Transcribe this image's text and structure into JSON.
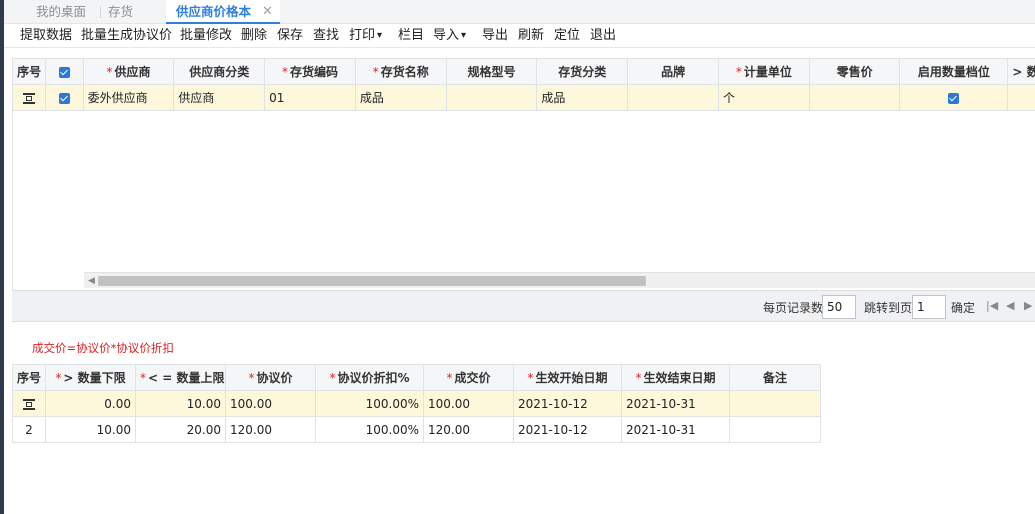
{
  "tabs": [
    {
      "label": "我的桌面"
    },
    {
      "label": "存货"
    },
    {
      "label": "供应商价格本",
      "active": true
    }
  ],
  "toolbar": {
    "fetch": "提取数据",
    "batch_generate": "批量生成协议价",
    "batch_edit": "批量修改",
    "delete": "删除",
    "save": "保存",
    "find": "查找",
    "print": "打印",
    "columns": "栏目",
    "import": "导入",
    "export": "导出",
    "refresh": "刷新",
    "locate": "定位",
    "exit": "退出"
  },
  "upper_grid": {
    "headers": {
      "seq": "序号",
      "supplier": "供应商",
      "supplier_class": "供应商分类",
      "item_code": "存货编码",
      "item_name": "存货名称",
      "spec": "规格型号",
      "item_class": "存货分类",
      "brand": "品牌",
      "unit": "计量单位",
      "retail_price": "零售价",
      "qty_tier": "启用数量档位",
      "more": "> 数"
    },
    "rows": [
      {
        "supplier": "委外供应商",
        "supplier_class": "供应商",
        "item_code": "01",
        "item_name": "成品",
        "spec": "",
        "item_class": "成品",
        "brand": "",
        "unit": "个",
        "retail_price": "",
        "qty_tier": true,
        "checked": true
      }
    ]
  },
  "pager": {
    "per_page_label": "每页记录数",
    "per_page": "50",
    "goto_label": "跳转到页",
    "goto_page": "1",
    "confirm": "确定"
  },
  "formula_note": "成交价=协议价*协议价折扣",
  "lower_grid": {
    "headers": {
      "seq": "序号",
      "qty_min": "> 数量下限",
      "qty_max": "< = 数量上限",
      "agreed_price": "协议价",
      "discount": "协议价折扣%",
      "deal_price": "成交价",
      "start_date": "生效开始日期",
      "end_date": "生效结束日期",
      "remark": "备注"
    },
    "rows": [
      {
        "seq": "",
        "qty_min": "0.00",
        "qty_max": "10.00",
        "agreed_price": "100.00",
        "discount": "100.00%",
        "deal_price": "100.00",
        "start_date": "2021-10-12",
        "end_date": "2021-10-31",
        "remark": ""
      },
      {
        "seq": "2",
        "qty_min": "10.00",
        "qty_max": "20.00",
        "agreed_price": "120.00",
        "discount": "100.00%",
        "deal_price": "120.00",
        "start_date": "2021-10-12",
        "end_date": "2021-10-31",
        "remark": ""
      }
    ]
  },
  "colors": {
    "accent": "#2f7fe0",
    "required": "#e02020",
    "selected_row": "#fdf7dc",
    "header_bg": "#f5f6f8"
  }
}
